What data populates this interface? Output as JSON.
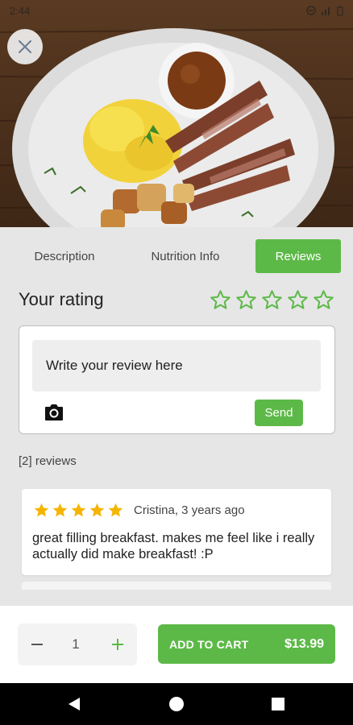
{
  "status_bar": {
    "time": "2:44"
  },
  "tabs": [
    {
      "label": "Description",
      "active": false
    },
    {
      "label": "Nutrition Info",
      "active": false
    },
    {
      "label": "Reviews",
      "active": true
    }
  ],
  "rating": {
    "label": "Your rating",
    "max_stars": 5,
    "current": 0
  },
  "review_form": {
    "placeholder": "Write your review here",
    "send_label": "Send"
  },
  "reviews": {
    "count_label": "[2] reviews",
    "items": [
      {
        "stars": 5,
        "author_line": "Cristina, 3 years ago",
        "text": "great filling breakfast.  makes me  feel like i really actually did make breakfast! :P"
      }
    ]
  },
  "cart": {
    "quantity": "1",
    "add_label": "ADD TO CART",
    "price": "$13.99"
  },
  "colors": {
    "accent": "#5cb947",
    "star_filled": "#f5b400",
    "star_outline": "#5cb947"
  },
  "icons": {
    "close": "close-icon",
    "camera": "camera-icon",
    "minus": "minus-icon",
    "plus": "plus-icon",
    "nav_back": "back-triangle-icon",
    "nav_home": "home-circle-icon",
    "nav_recent": "recent-square-icon"
  }
}
